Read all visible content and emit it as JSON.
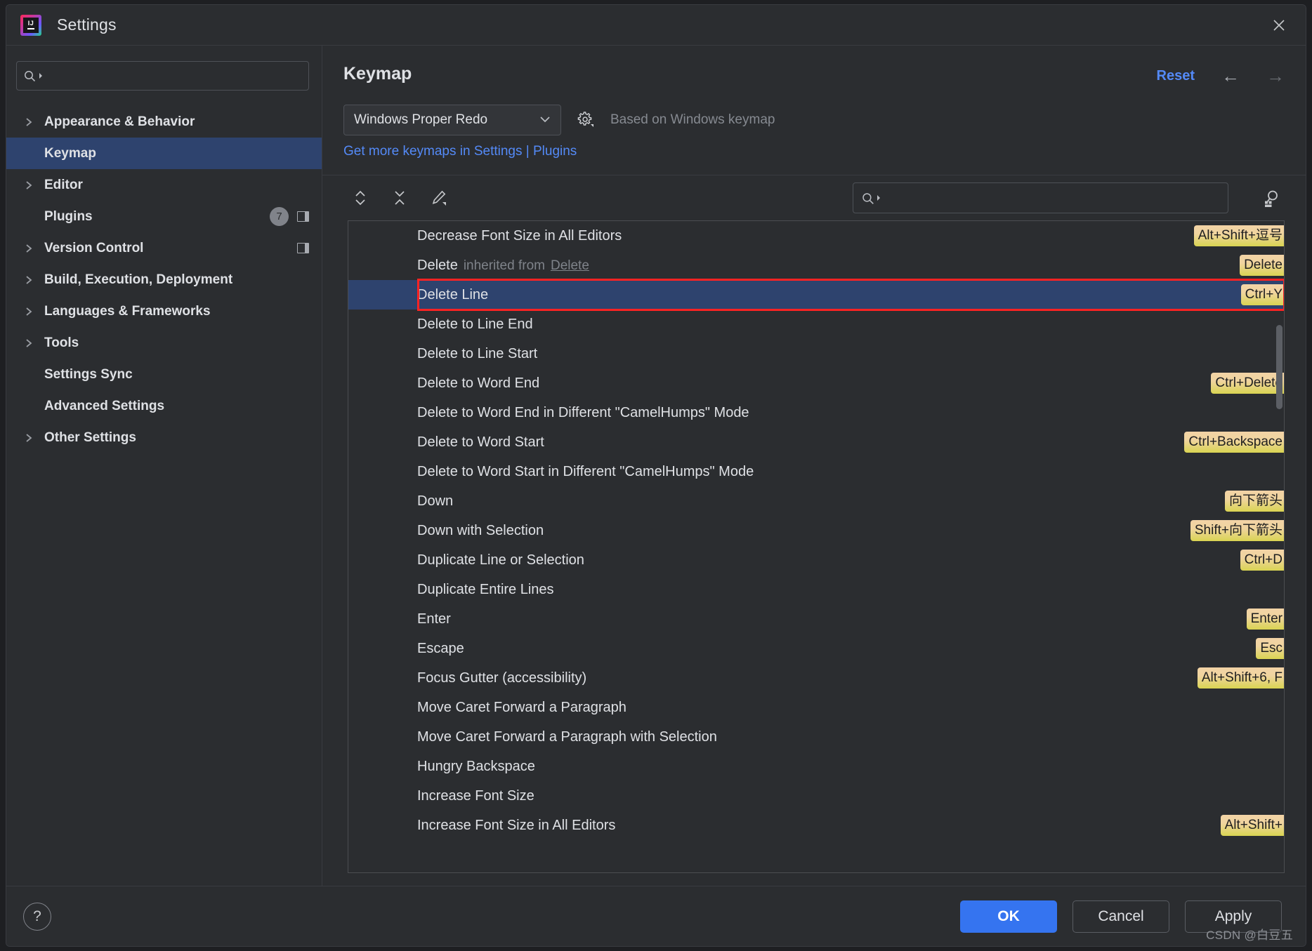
{
  "window": {
    "title": "Settings",
    "logo_text": "IJ",
    "close_icon": "close-icon"
  },
  "sidebar": {
    "search": {
      "value": "",
      "placeholder": ""
    },
    "items": [
      {
        "label": "Appearance & Behavior",
        "expandable": true,
        "selected": false,
        "badge": null,
        "panel_icon": false
      },
      {
        "label": "Keymap",
        "expandable": false,
        "selected": true,
        "badge": null,
        "panel_icon": false
      },
      {
        "label": "Editor",
        "expandable": true,
        "selected": false,
        "badge": null,
        "panel_icon": false
      },
      {
        "label": "Plugins",
        "expandable": false,
        "selected": false,
        "badge": "7",
        "panel_icon": true
      },
      {
        "label": "Version Control",
        "expandable": true,
        "selected": false,
        "badge": null,
        "panel_icon": true
      },
      {
        "label": "Build, Execution, Deployment",
        "expandable": true,
        "selected": false,
        "badge": null,
        "panel_icon": false
      },
      {
        "label": "Languages & Frameworks",
        "expandable": true,
        "selected": false,
        "badge": null,
        "panel_icon": false
      },
      {
        "label": "Tools",
        "expandable": true,
        "selected": false,
        "badge": null,
        "panel_icon": false
      },
      {
        "label": "Settings Sync",
        "expandable": false,
        "selected": false,
        "badge": null,
        "panel_icon": false
      },
      {
        "label": "Advanced Settings",
        "expandable": false,
        "selected": false,
        "badge": null,
        "panel_icon": false
      },
      {
        "label": "Other Settings",
        "expandable": true,
        "selected": false,
        "badge": null,
        "panel_icon": false
      }
    ]
  },
  "main": {
    "page_title": "Keymap",
    "reset_label": "Reset",
    "back_arrow": "←",
    "forward_arrow": "→",
    "keymap_select": "Windows Proper Redo",
    "based_on": "Based on Windows keymap",
    "plugins_link": "Get more keymaps in Settings | Plugins",
    "toolbar": {
      "expand_all_icon": "expand-all-icon",
      "collapse_all_icon": "collapse-all-icon",
      "edit_shortcut_icon": "edit-pencil-icon",
      "find_by_shortcut_icon": "find-by-shortcut-icon"
    },
    "list_search": {
      "value": "",
      "placeholder": ""
    },
    "rows": [
      {
        "label": "Decrease Font Size in All Editors",
        "shortcut": "Alt+Shift+逗号",
        "selected": false
      },
      {
        "label": "Delete",
        "inherit_text": "inherited from",
        "inherit_link": "Delete",
        "shortcut": "Delete",
        "selected": false
      },
      {
        "label": "Delete Line",
        "shortcut": "Ctrl+Y",
        "selected": true
      },
      {
        "label": "Delete to Line End",
        "shortcut": "",
        "selected": false
      },
      {
        "label": "Delete to Line Start",
        "shortcut": "",
        "selected": false
      },
      {
        "label": "Delete to Word End",
        "shortcut": "Ctrl+Delete",
        "selected": false
      },
      {
        "label": "Delete to Word End in Different \"CamelHumps\" Mode",
        "shortcut": "",
        "selected": false
      },
      {
        "label": "Delete to Word Start",
        "shortcut": "Ctrl+Backspace",
        "selected": false
      },
      {
        "label": "Delete to Word Start in Different \"CamelHumps\" Mode",
        "shortcut": "",
        "selected": false
      },
      {
        "label": "Down",
        "shortcut": "向下箭头",
        "selected": false
      },
      {
        "label": "Down with Selection",
        "shortcut": "Shift+向下箭头",
        "selected": false
      },
      {
        "label": "Duplicate Line or Selection",
        "shortcut": "Ctrl+D",
        "selected": false
      },
      {
        "label": "Duplicate Entire Lines",
        "shortcut": "",
        "selected": false
      },
      {
        "label": "Enter",
        "shortcut": "Enter",
        "selected": false
      },
      {
        "label": "Escape",
        "shortcut": "Esc",
        "selected": false
      },
      {
        "label": "Focus Gutter (accessibility)",
        "shortcut": "Alt+Shift+6, F",
        "selected": false
      },
      {
        "label": "Move Caret Forward a Paragraph",
        "shortcut": "",
        "selected": false
      },
      {
        "label": "Move Caret Forward a Paragraph with Selection",
        "shortcut": "",
        "selected": false
      },
      {
        "label": "Hungry Backspace",
        "shortcut": "",
        "selected": false
      },
      {
        "label": "Increase Font Size",
        "shortcut": "",
        "selected": false
      },
      {
        "label": "Increase Font Size in All Editors",
        "shortcut": "Alt+Shift+",
        "selected": false
      }
    ]
  },
  "footer": {
    "help_label": "?",
    "ok_label": "OK",
    "cancel_label": "Cancel",
    "apply_label": "Apply",
    "watermark": "CSDN @白豆五"
  },
  "colors": {
    "accent_blue": "#3574f0",
    "link_blue": "#548af7",
    "selection_blue": "#2e436e",
    "shortcut_badge": "#e9d49a",
    "highlight_red": "#ff2323",
    "window_bg": "#2b2d30"
  }
}
